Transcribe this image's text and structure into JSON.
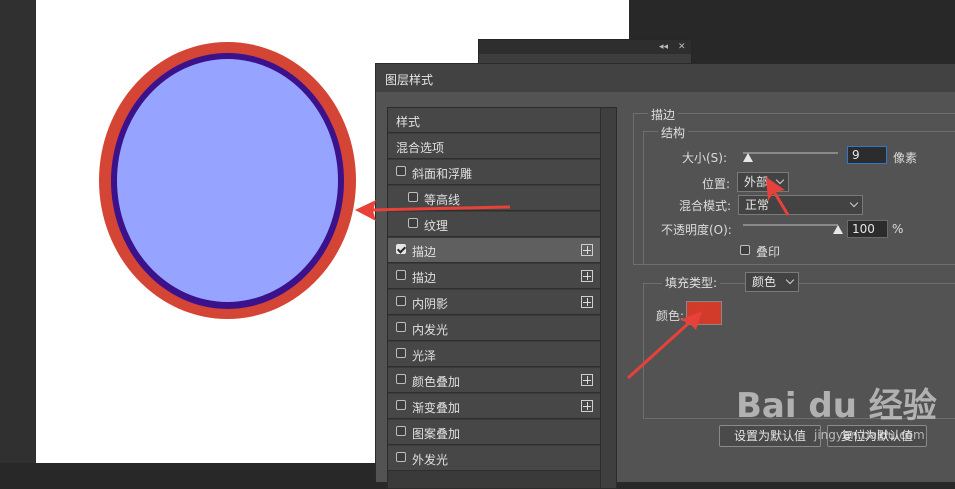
{
  "dialog": {
    "title": "图层样式"
  },
  "style_list": {
    "items": [
      {
        "label": "样式",
        "checkbox": false,
        "checked": false,
        "plus": false,
        "indent": 0
      },
      {
        "label": "混合选项",
        "checkbox": false,
        "checked": false,
        "plus": false,
        "indent": 0
      },
      {
        "label": "斜面和浮雕",
        "checkbox": true,
        "checked": false,
        "plus": false,
        "indent": 0
      },
      {
        "label": "等高线",
        "checkbox": true,
        "checked": false,
        "plus": false,
        "indent": 1
      },
      {
        "label": "纹理",
        "checkbox": true,
        "checked": false,
        "plus": false,
        "indent": 1
      },
      {
        "label": "描边",
        "checkbox": true,
        "checked": true,
        "plus": true,
        "indent": 0,
        "active": true
      },
      {
        "label": "描边",
        "checkbox": true,
        "checked": false,
        "plus": true,
        "indent": 0
      },
      {
        "label": "内阴影",
        "checkbox": true,
        "checked": false,
        "plus": true,
        "indent": 0
      },
      {
        "label": "内发光",
        "checkbox": true,
        "checked": false,
        "plus": false,
        "indent": 0
      },
      {
        "label": "光泽",
        "checkbox": true,
        "checked": false,
        "plus": false,
        "indent": 0
      },
      {
        "label": "颜色叠加",
        "checkbox": true,
        "checked": false,
        "plus": true,
        "indent": 0
      },
      {
        "label": "渐变叠加",
        "checkbox": true,
        "checked": false,
        "plus": true,
        "indent": 0
      },
      {
        "label": "图案叠加",
        "checkbox": true,
        "checked": false,
        "plus": false,
        "indent": 0
      },
      {
        "label": "外发光",
        "checkbox": true,
        "checked": false,
        "plus": false,
        "indent": 0
      }
    ]
  },
  "stroke": {
    "section_title": "描边",
    "structure_title": "结构",
    "size_label": "大小(S):",
    "size_value": "9",
    "size_unit": "像素",
    "position_label": "位置:",
    "position_value": "外部",
    "blend_label": "混合模式:",
    "blend_value": "正常",
    "opacity_label": "不透明度(O):",
    "opacity_value": "100",
    "opacity_unit": "%",
    "overprint_label": "叠印",
    "overprint_checked": false,
    "fill_type_label": "填充类型:",
    "fill_type_value": "颜色",
    "color_label": "颜色:",
    "color_value": "#d23b2a"
  },
  "buttons": {
    "set_default": "设置为默认值",
    "reset_default": "复位为默认值"
  },
  "canvas": {
    "outer_stroke_color": "#d44536",
    "inner_stroke_color": "#3b128c",
    "fill_color": "#96a3ff"
  },
  "annotation_color": "#e8413a",
  "watermark": {
    "logo": "Bai du 经验",
    "site": "jingyan.baidu.com"
  }
}
